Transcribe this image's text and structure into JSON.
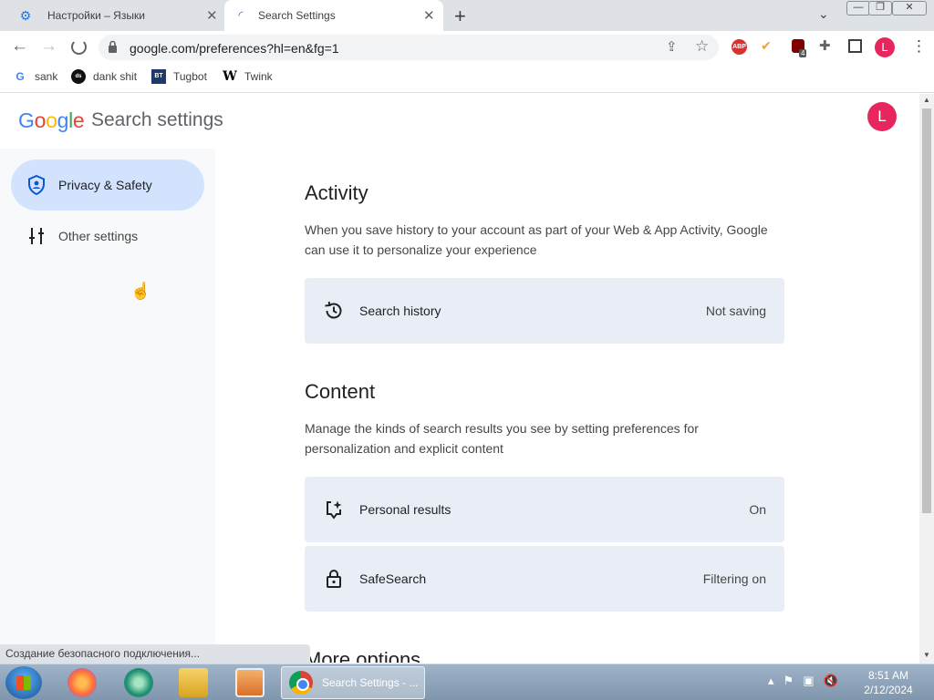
{
  "browser": {
    "tabs": [
      {
        "title": "Настройки – Языки",
        "icon": "gear-icon"
      },
      {
        "title": "Search Settings",
        "icon": "loading-icon"
      }
    ],
    "url": "google.com/preferences?hl=en&fg=1",
    "profile_initial": "L",
    "extensions": {
      "abp_label": "ABP",
      "ublock_badge": "4"
    },
    "bookmarks": [
      {
        "label": "sank",
        "icon_text": "G"
      },
      {
        "label": "dank shit",
        "icon_text": "ds"
      },
      {
        "label": "Tugbot",
        "icon_text": "BT"
      },
      {
        "label": "Twink",
        "icon_text": "W"
      }
    ],
    "status_text": "Создание безопасного подключения..."
  },
  "page": {
    "logo": [
      "G",
      "o",
      "o",
      "g",
      "l",
      "e"
    ],
    "logo_colors": [
      "#4285f4",
      "#ea4335",
      "#fbbc05",
      "#4285f4",
      "#34a853",
      "#ea4335"
    ],
    "title": "Search settings",
    "avatar_initial": "L",
    "nav": [
      {
        "label": "Privacy & Safety",
        "icon": "shield-icon",
        "selected": true
      },
      {
        "label": "Other settings",
        "icon": "sliders-icon",
        "selected": false
      }
    ],
    "activity": {
      "title": "Activity",
      "description": "When you save history to your account as part of your Web & App Activity, Google can use it to personalize your experience",
      "cards": [
        {
          "label": "Search history",
          "value": "Not saving",
          "icon": "history-icon"
        }
      ]
    },
    "content": {
      "title": "Content",
      "description": "Manage the kinds of search results you see by setting preferences for personalization and explicit content",
      "cards": [
        {
          "label": "Personal results",
          "value": "On",
          "icon": "personal-results-icon"
        },
        {
          "label": "SafeSearch",
          "value": "Filtering on",
          "icon": "lock-icon"
        }
      ]
    },
    "more_title": "More options"
  },
  "taskbar": {
    "chrome_label": "Search Settings - ...",
    "time": "8:51 AM",
    "date": "2/12/2024"
  },
  "colors": {
    "accent": "#1a73e8",
    "nav_selected_bg": "#d3e3fd",
    "card_bg": "#e9eef6",
    "avatar": "#e8265e"
  }
}
